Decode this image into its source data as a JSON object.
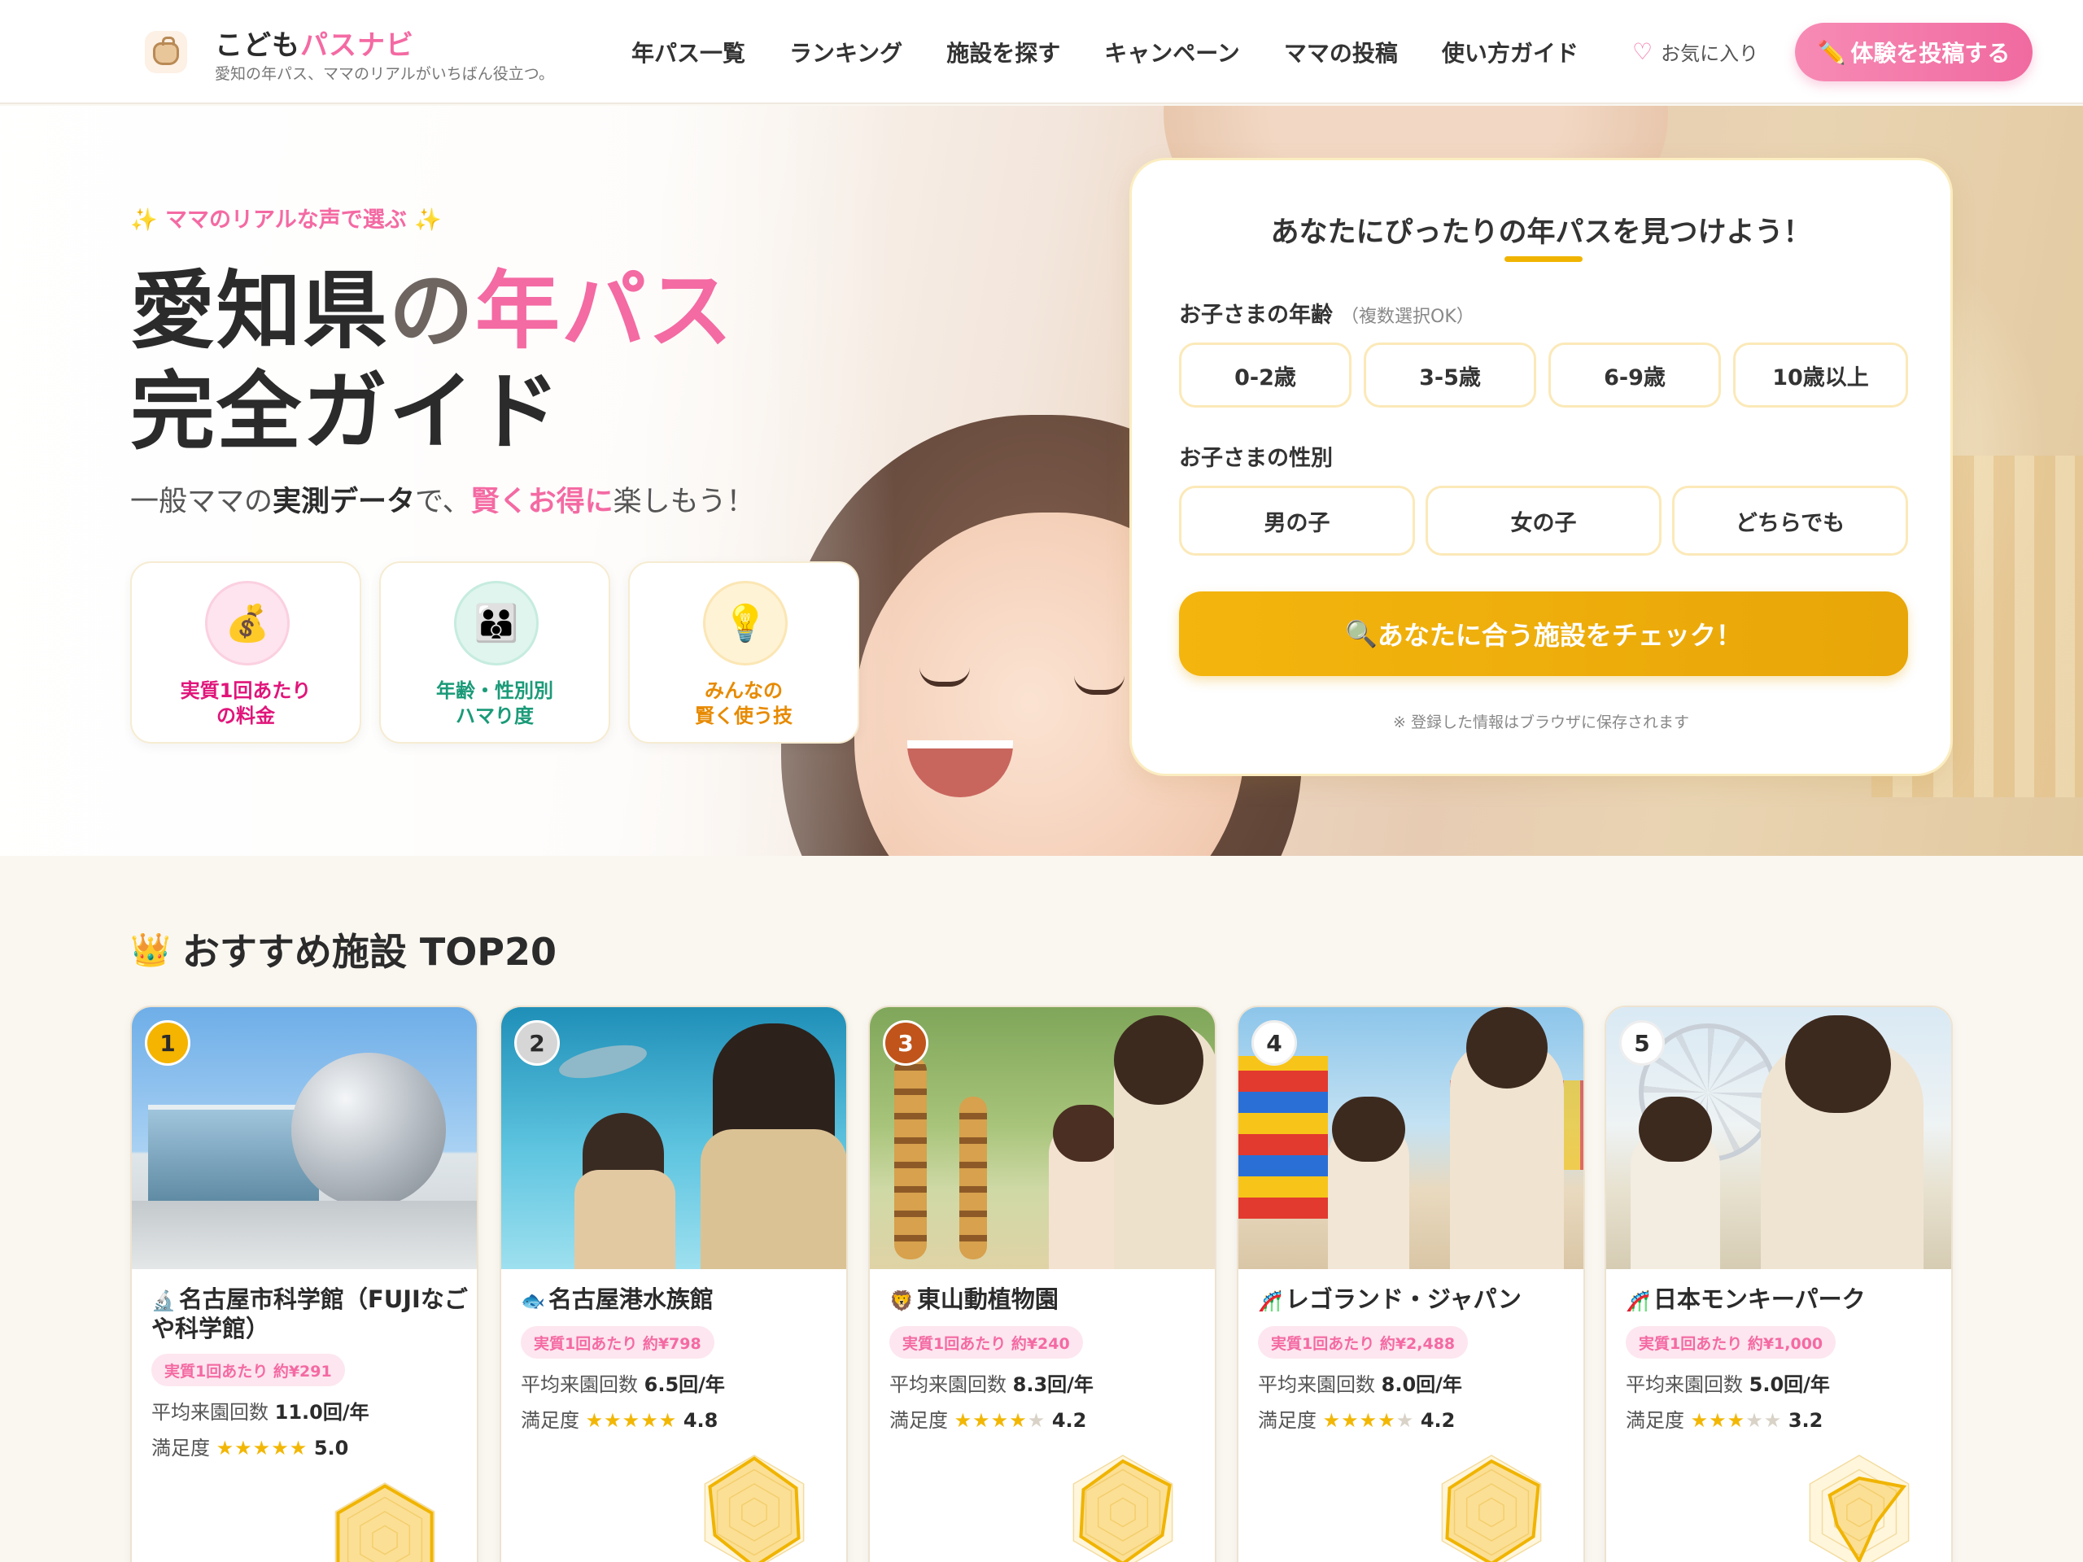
{
  "header": {
    "brand_part1": "こども",
    "brand_part2": "パスナビ",
    "tagline": "愛知の年パス、ママのリアルがいちばん役立つ。",
    "nav": [
      "年パス一覧",
      "ランキング",
      "施設を探す",
      "キャンペーン",
      "ママの投稿",
      "使い方ガイド"
    ],
    "favorites_label": "お気に入り",
    "post_button": "体験を投稿する"
  },
  "hero": {
    "kicker": "ママのリアルな声で選ぶ",
    "title_part1": "愛知県",
    "title_part2": "の",
    "title_part3": "年パス",
    "title_line2": "完全ガイド",
    "sub_part1": "一般ママの",
    "sub_part2": "実測データ",
    "sub_part3": "で、",
    "sub_part4": "賢くお得に",
    "sub_part5": "楽しもう！",
    "features": [
      {
        "line1": "実質1回あたり",
        "line2": "の料金",
        "icon": "money-bag-icon",
        "color": "#e0157a"
      },
      {
        "line1": "年齢・性別別",
        "line2": "ハマり度",
        "icon": "family-icon",
        "color": "#1a9a78"
      },
      {
        "line1": "みんなの",
        "line2": "賢く使う技",
        "icon": "lightbulb-icon",
        "color": "#e78a00"
      }
    ]
  },
  "finder": {
    "title": "あなたにぴったりの年パスを見つけよう！",
    "age_label": "お子さまの年齢",
    "age_note": "（複数選択OK）",
    "ages": [
      "0-2歳",
      "3-5歳",
      "6-9歳",
      "10歳以上"
    ],
    "gender_label": "お子さまの性別",
    "genders": [
      "男の子",
      "女の子",
      "どちらでも"
    ],
    "check_button": "あなたに合う施設をチェック！",
    "note": "※ 登録した情報はブラウザに保存されます"
  },
  "ranking": {
    "title": "おすすめ施設 TOP20",
    "visits_label": "平均来園回数",
    "satisfaction_label": "満足度",
    "items": [
      {
        "rank": "1",
        "name": "名古屋市科学館（FUJIなごや科学館）",
        "icon": "microscope-icon",
        "price": "実質1回あたり 約¥291",
        "visits": "11.0回/年",
        "rating": 5.0,
        "rating_text": "5.0",
        "rank_color": "#f4b400"
      },
      {
        "rank": "2",
        "name": "名古屋港水族館",
        "icon": "fish-icon",
        "price": "実質1回あたり 約¥798",
        "visits": "6.5回/年",
        "rating": 4.8,
        "rating_text": "4.8",
        "rank_color": "#cfcfcf"
      },
      {
        "rank": "3",
        "name": "東山動植物園",
        "icon": "lion-icon",
        "price": "実質1回あたり 約¥240",
        "visits": "8.3回/年",
        "rating": 4.2,
        "rating_text": "4.2",
        "rank_color": "#c0541a"
      },
      {
        "rank": "4",
        "name": "レゴランド・ジャパン",
        "icon": "roller-coaster-icon",
        "price": "実質1回あたり 約¥2,488",
        "visits": "8.0回/年",
        "rating": 4.2,
        "rating_text": "4.2",
        "rank_color": "#ffffff"
      },
      {
        "rank": "5",
        "name": "日本モンキーパーク",
        "icon": "roller-coaster-icon",
        "price": "実質1回あたり 約¥1,000",
        "visits": "5.0回/年",
        "rating": 3.2,
        "rating_text": "3.2",
        "rank_color": "#ffffff"
      }
    ]
  }
}
